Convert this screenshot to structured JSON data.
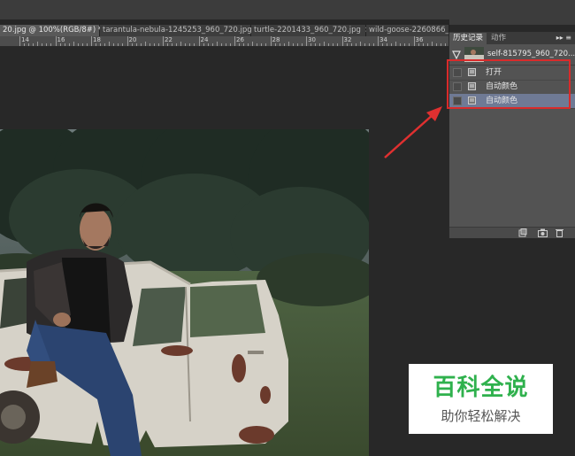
{
  "tabs": [
    {
      "label": "20.jpg @ 100%(RGB/8#) *",
      "close": "×",
      "active": true
    },
    {
      "label": "tarantula-nebula-1245253_960_720.jpg",
      "close": "×",
      "active": false
    },
    {
      "label": "turtle-2201433_960_720.jpg",
      "close": "×",
      "active": false
    },
    {
      "label": "wild-goose-2260866_960_720.j",
      "close": "",
      "active": false
    }
  ],
  "ruler": {
    "labels": [
      "14",
      "16",
      "18",
      "20",
      "22",
      "24",
      "26",
      "28",
      "30",
      "32",
      "34",
      "36"
    ]
  },
  "panel": {
    "tab_history": "历史记录",
    "tab_actions": "动作",
    "menu": "▸▸ ≡",
    "snapshot_label": "self-815795_960_720....",
    "history_items": [
      {
        "label": "打开",
        "selected": false
      },
      {
        "label": "自动颜色",
        "selected": false
      },
      {
        "label": "自动颜色",
        "selected": true
      }
    ],
    "footer_icons": [
      "new-document-from-state-icon",
      "camera-icon",
      "trash-icon"
    ]
  },
  "watermark": {
    "title": "百科全说",
    "subtitle": "助你轻松解决"
  },
  "colors": {
    "highlight": "#d92b2b",
    "watermark_green": "#2fb14d",
    "selected_row": "#6f7a95"
  }
}
